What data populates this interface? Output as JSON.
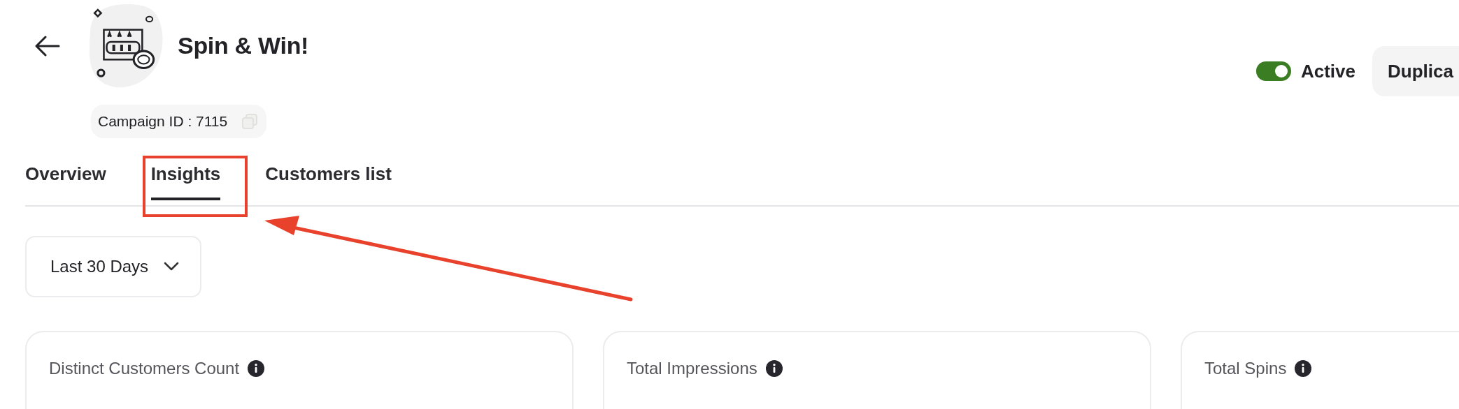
{
  "header": {
    "title": "Spin & Win!",
    "campaign_id": "Campaign ID : 7115",
    "status": {
      "label": "Active",
      "on": true
    },
    "action_button": "Duplica"
  },
  "tabs": [
    {
      "label": "Overview",
      "selected": false
    },
    {
      "label": "Insights",
      "selected": true
    },
    {
      "label": "Customers list",
      "selected": false
    }
  ],
  "date_range": {
    "value": "Last 30 Days"
  },
  "cards": [
    {
      "title": "Distinct Customers Count"
    },
    {
      "title": "Total Impressions"
    },
    {
      "title": "Total Spins"
    }
  ]
}
